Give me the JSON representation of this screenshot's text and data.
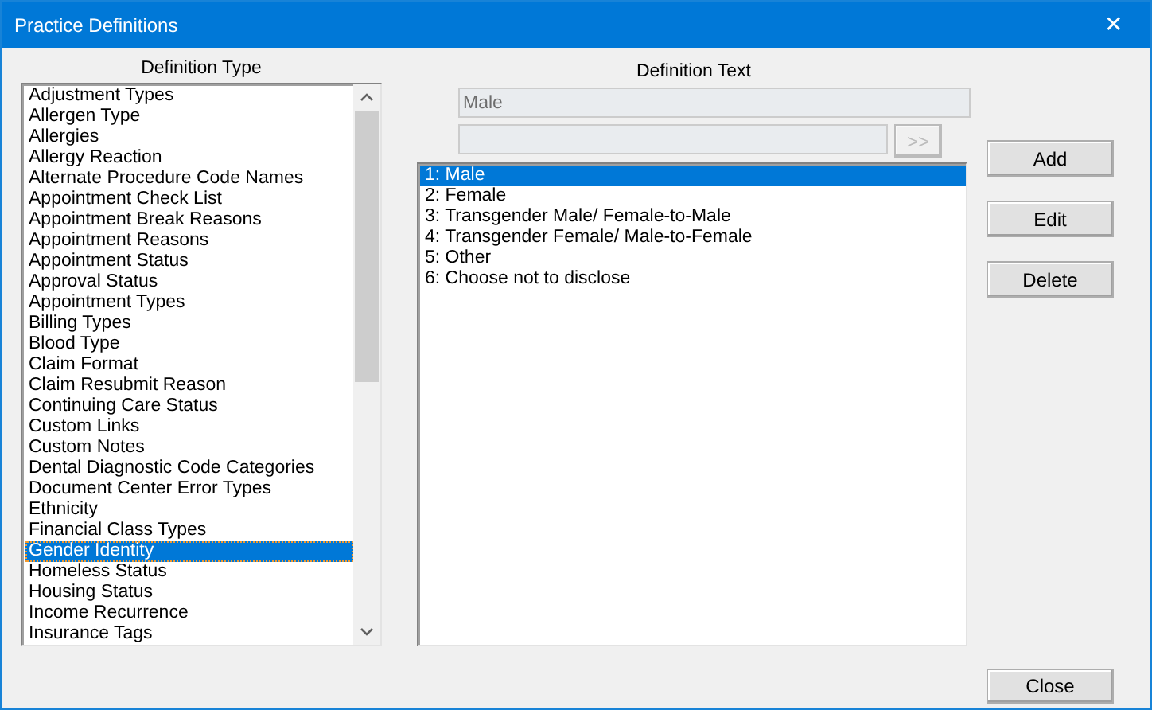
{
  "window": {
    "title": "Practice Definitions",
    "close": "✕"
  },
  "definition_type": {
    "label": "Definition Type",
    "items": [
      {
        "label": "Adjustment Types",
        "selected": false
      },
      {
        "label": "Allergen Type",
        "selected": false
      },
      {
        "label": "Allergies",
        "selected": false
      },
      {
        "label": "Allergy Reaction",
        "selected": false
      },
      {
        "label": "Alternate Procedure Code Names",
        "selected": false
      },
      {
        "label": "Appointment Check List",
        "selected": false
      },
      {
        "label": "Appointment Break Reasons",
        "selected": false
      },
      {
        "label": "Appointment Reasons",
        "selected": false
      },
      {
        "label": "Appointment Status",
        "selected": false
      },
      {
        "label": "Approval Status",
        "selected": false
      },
      {
        "label": "Appointment Types",
        "selected": false
      },
      {
        "label": "Billing Types",
        "selected": false
      },
      {
        "label": "Blood Type",
        "selected": false
      },
      {
        "label": "Claim Format",
        "selected": false
      },
      {
        "label": "Claim Resubmit Reason",
        "selected": false
      },
      {
        "label": "Continuing Care Status",
        "selected": false
      },
      {
        "label": "Custom Links",
        "selected": false
      },
      {
        "label": "Custom Notes",
        "selected": false
      },
      {
        "label": "Dental Diagnostic Code Categories",
        "selected": false
      },
      {
        "label": "Document Center Error Types",
        "selected": false
      },
      {
        "label": "Ethnicity",
        "selected": false
      },
      {
        "label": "Financial Class Types",
        "selected": false
      },
      {
        "label": "Gender Identity",
        "selected": true
      },
      {
        "label": "Homeless Status",
        "selected": false
      },
      {
        "label": "Housing Status",
        "selected": false
      },
      {
        "label": "Income Recurrence",
        "selected": false
      },
      {
        "label": "Insurance Tags",
        "selected": false
      }
    ]
  },
  "definition_text": {
    "label": "Definition Text",
    "value": "Male",
    "disabled": true
  },
  "second_field": {
    "disabled": true
  },
  "move_button": {
    "label": ">>",
    "disabled": true
  },
  "definitions": [
    {
      "label": "1: Male",
      "selected": true
    },
    {
      "label": "2: Female",
      "selected": false
    },
    {
      "label": "3: Transgender Male/ Female-to-Male",
      "selected": false
    },
    {
      "label": "4: Transgender Female/ Male-to-Female",
      "selected": false
    },
    {
      "label": "5: Other",
      "selected": false
    },
    {
      "label": "6: Choose not to disclose",
      "selected": false
    }
  ],
  "buttons": [
    {
      "label": "Add"
    },
    {
      "label": "Edit"
    },
    {
      "label": "Delete"
    }
  ],
  "close_button": {
    "label": "Close"
  }
}
